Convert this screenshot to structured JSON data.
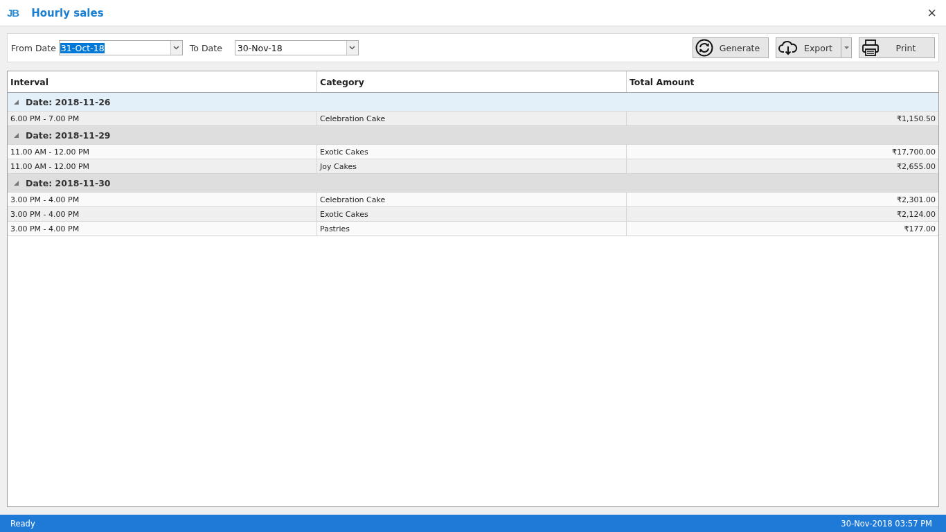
{
  "window": {
    "logo": "JB",
    "title": "Hourly sales",
    "close": "×"
  },
  "filters": [
    {
      "label": "From Date",
      "value": "31-Oct-18",
      "text_selected": true
    },
    {
      "label": "To Date",
      "value": "30-Nov-18",
      "text_selected": false
    }
  ],
  "actions": [
    {
      "kind": "generate",
      "label": "Generate",
      "dropdown": false
    },
    {
      "kind": "export",
      "label": "Export",
      "dropdown": true
    },
    {
      "kind": "print",
      "label": "Print",
      "dropdown": false
    }
  ],
  "table": {
    "columns": [
      "Interval",
      "Category",
      "Total Amount"
    ],
    "groups": [
      {
        "label": "Date: 2018-11-26",
        "selected": true,
        "expanded": true,
        "rows": [
          {
            "interval": "6.00 PM - 7.00 PM",
            "category": "Celebration Cake",
            "total": "₹1,150.50"
          }
        ]
      },
      {
        "label": "Date: 2018-11-29",
        "selected": false,
        "expanded": true,
        "rows": [
          {
            "interval": "11.00 AM - 12.00 PM",
            "category": "Exotic Cakes",
            "total": "₹17,700.00"
          },
          {
            "interval": "11.00 AM - 12.00 PM",
            "category": "Joy Cakes",
            "total": "₹2,655.00"
          }
        ]
      },
      {
        "label": "Date: 2018-11-30",
        "selected": false,
        "expanded": true,
        "rows": [
          {
            "interval": "3.00 PM - 4.00 PM",
            "category": "Celebration Cake",
            "total": "₹2,301.00"
          },
          {
            "interval": "3.00 PM - 4.00 PM",
            "category": "Exotic Cakes",
            "total": "₹2,124.00"
          },
          {
            "interval": "3.00 PM - 4.00 PM",
            "category": "Pastries",
            "total": "₹177.00"
          }
        ]
      }
    ]
  },
  "status_bar": {
    "status": "Ready",
    "datetime": "30-Nov-2018 03:57 PM"
  }
}
